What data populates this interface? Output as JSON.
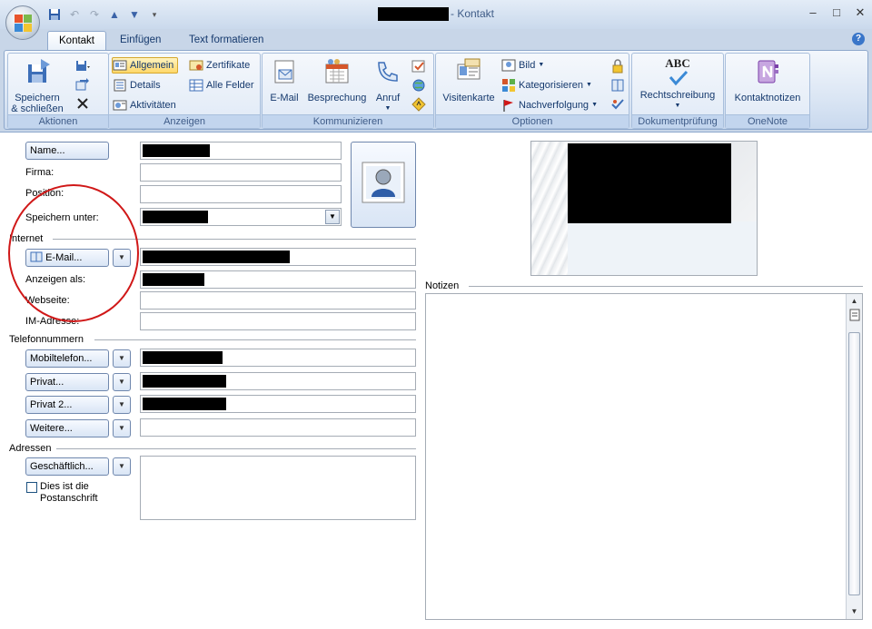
{
  "window": {
    "title_suffix": "- Kontakt",
    "controls": {
      "minimize": "‒",
      "maximize": "□",
      "close": "✕"
    }
  },
  "tabs": [
    {
      "label": "Kontakt",
      "active": true
    },
    {
      "label": "Einfügen",
      "active": false
    },
    {
      "label": "Text formatieren",
      "active": false
    }
  ],
  "help_label": "?",
  "ribbon": {
    "aktionen": {
      "label": "Aktionen",
      "save_close_line1": "Speichern",
      "save_close_line2": "& schließen"
    },
    "anzeigen": {
      "label": "Anzeigen",
      "allgemein": "Allgemein",
      "details": "Details",
      "aktivitaeten": "Aktivitäten",
      "zertifikate": "Zertifikate",
      "alle_felder": "Alle Felder"
    },
    "kommunizieren": {
      "label": "Kommunizieren",
      "email": "E-Mail",
      "besprechung": "Besprechung",
      "anruf": "Anruf"
    },
    "optionen": {
      "label": "Optionen",
      "visitenkarte": "Visitenkarte",
      "bild": "Bild",
      "kategorisieren": "Kategorisieren",
      "nachverfolgung": "Nachverfolgung"
    },
    "dokumentpruefung": {
      "label": "Dokumentprüfung",
      "rechtschreibung": "Rechtschreibung",
      "abc": "ABC"
    },
    "onenote": {
      "label": "OneNote",
      "kontaktnotizen": "Kontaktnotizen"
    }
  },
  "form": {
    "name_button": "Name...",
    "firma": "Firma:",
    "position": "Position:",
    "speichern_unter": "Speichern unter:",
    "internet_section": "Internet",
    "email_button": "E-Mail...",
    "anzeigen_als": "Anzeigen als:",
    "webseite": "Webseite:",
    "im_adresse": "IM-Adresse:",
    "telefon_section": "Telefonnummern",
    "mobiltelefon": "Mobiltelefon...",
    "privat": "Privat...",
    "privat2": "Privat 2...",
    "weitere": "Weitere...",
    "adressen_section": "Adressen",
    "geschaeftlich": "Geschäftlich...",
    "postanschrift_line1": "Dies ist die",
    "postanschrift_line2": "Postanschrift",
    "notizen": "Notizen"
  }
}
